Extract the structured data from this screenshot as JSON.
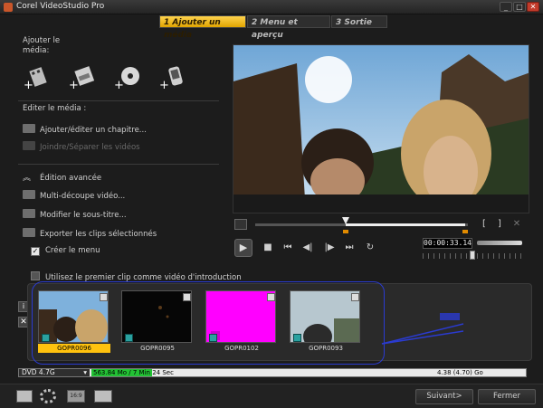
{
  "window": {
    "title": "Corel VideoStudio Pro",
    "min": "_",
    "max": "□",
    "close": "✕"
  },
  "steps": [
    {
      "num": "1",
      "label": "Ajouter un média"
    },
    {
      "num": "2",
      "label": "Menu et aperçu"
    },
    {
      "num": "3",
      "label": "Sortie"
    }
  ],
  "left": {
    "add_media_label": "Ajouter le média:",
    "edit_media_label": "Editer le média :",
    "add_chapter": "Ajouter/éditer un chapitre...",
    "join_split": "Joindre/Séparer les vidéos",
    "advanced": "Édition avancée",
    "multi_trim": "Multi-découpe vidéo...",
    "subtitle": "Modifier le sous-titre...",
    "export": "Exporter les clips sélectionnés",
    "create_menu": "Créer le menu",
    "intro_checkbox": "Utilisez le premier clip comme vidéo d'introduction"
  },
  "player": {
    "timecode": "00:00:33.14"
  },
  "clips": [
    {
      "name": "GOPR0096",
      "selected": true
    },
    {
      "name": "GOPR0095",
      "selected": false
    },
    {
      "name": "GOPR0102",
      "selected": false
    },
    {
      "name": "GOPR0093",
      "selected": false
    }
  ],
  "disc": {
    "type": "DVD 4.7G",
    "used": "563.84 Mo",
    "duration": "/ 7 Min 24 Sec",
    "capacity": "4.38 (4.70) Go",
    "fill_fraction": 0.14
  },
  "footer": {
    "next": "Suivant>",
    "close": "Fermer"
  }
}
